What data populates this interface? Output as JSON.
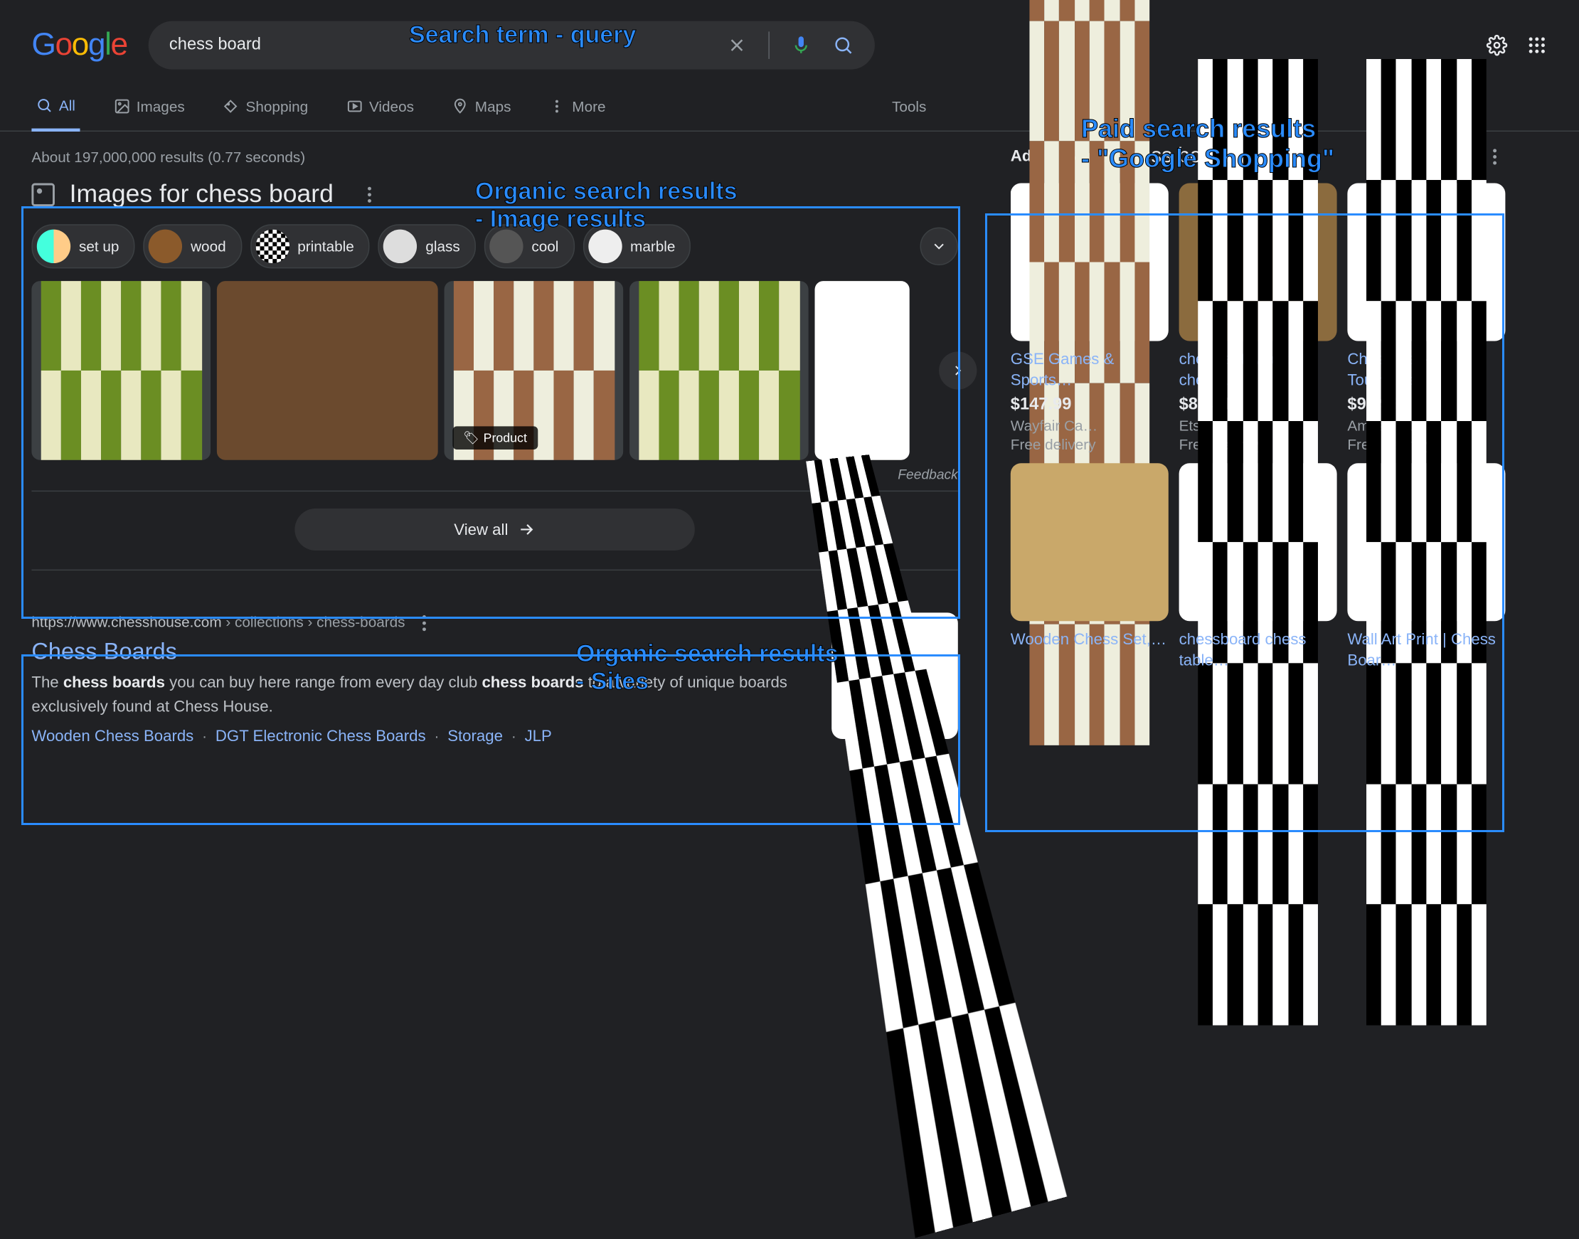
{
  "search": {
    "query": "chess board"
  },
  "tabs": [
    "All",
    "Images",
    "Shopping",
    "Videos",
    "Maps",
    "More"
  ],
  "tools": "Tools",
  "stats": "About 197,000,000 results (0.77 seconds)",
  "images_block": {
    "title": "Images for chess board",
    "chips": [
      "set up",
      "wood",
      "printable",
      "glass",
      "cool",
      "marble"
    ],
    "product_tag": "Product",
    "feedback": "Feedback",
    "view_all": "View all"
  },
  "result": {
    "url": "https://www.chesshouse.com",
    "path": " › collections › chess-boards",
    "title": "Chess Boards",
    "desc_pre": "The ",
    "desc_b1": "chess boards",
    "desc_mid": " you can buy here range from every day club ",
    "desc_b2": "chess boards",
    "desc_post": " to a variety of unique boards exclusively found at Chess House.",
    "sitelinks": [
      "Wooden Chess Boards",
      "DGT Electronic Chess Boards",
      "Storage",
      "JLP"
    ]
  },
  "shopping": {
    "ads": "Ads",
    "title": "Shop chess board",
    "items": [
      {
        "title": "GSE Games & Sports…",
        "price": "$147.99",
        "store": "Wayfair Ca…",
        "ship": "Free delivery"
      },
      {
        "title": "chess set, wood chess…",
        "price": "$88.54",
        "store": "Etsy",
        "ship": "Free delivery"
      },
      {
        "title": "Chess Set - Tournament…",
        "price": "$99.99",
        "store": "Amazon CA",
        "ship": "Free delivery"
      },
      {
        "title": "Wooden Chess Set,…",
        "price": "",
        "store": "",
        "ship": ""
      },
      {
        "title": "chessboard chess table…",
        "price": "",
        "store": "",
        "ship": ""
      },
      {
        "title": "Wall Art Print | Chess Boar…",
        "price": "",
        "store": "",
        "ship": ""
      }
    ]
  },
  "annotations": {
    "query": "Search term - query",
    "organic_images": "Organic search results\n- Image results",
    "organic_sites": "Organic search results\n- Sites",
    "paid": "Paid search results\n- \"Google Shopping\""
  }
}
